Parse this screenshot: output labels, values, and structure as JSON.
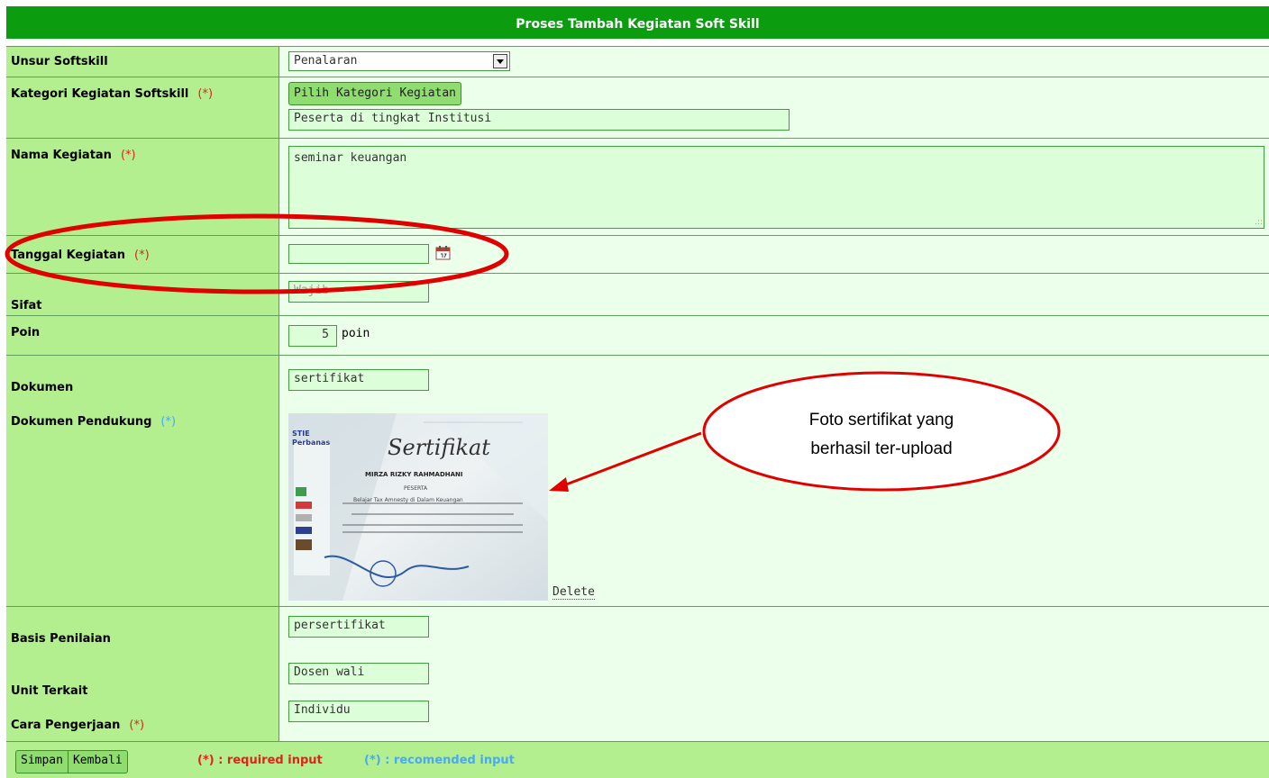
{
  "form": {
    "title": "Proses Tambah Kegiatan Soft Skill",
    "required_marker": "(*)",
    "recommended_marker": "(*)",
    "fields": {
      "unsur": {
        "label": "Unsur Softskill",
        "value": "Penalaran"
      },
      "kategori": {
        "label": "Kategori Kegiatan Softskill",
        "button": "Pilih Kategori Kegiatan",
        "value": "Peserta di tingkat Institusi"
      },
      "nama": {
        "label": "Nama Kegiatan",
        "value": "seminar keuangan"
      },
      "tanggal": {
        "label": "Tanggal Kegiatan",
        "value": ""
      },
      "sifat": {
        "label": "Sifat",
        "value": "Wajib"
      },
      "poin": {
        "label": "Poin",
        "value": "5",
        "unit": "poin"
      },
      "dokumen": {
        "label": "Dokumen",
        "value": "sertifikat"
      },
      "dokumen_pendukung": {
        "label": "Dokumen Pendukung",
        "delete_label": "Delete"
      },
      "basis": {
        "label": "Basis Penilaian",
        "value": "persertifikat"
      },
      "unit": {
        "label": "Unit Terkait",
        "value": "Dosen wali"
      },
      "cara": {
        "label": "Cara Pengerjaan",
        "value": "Individu"
      }
    },
    "buttons": {
      "simpan": "Simpan",
      "kembali": "Kembali"
    },
    "legend": {
      "required": "(*) : required input",
      "recommended": "(*) : recomended input"
    }
  },
  "certificate": {
    "title": "Sertifikat",
    "logo_text": "STIE Perbanas",
    "name_text": "MIRZA RIZKY RAHMADHANI",
    "role_text": "PESERTA",
    "event_text": "Belajar Tax Amnesty di Dalam Keuangan"
  },
  "callout": {
    "line1": "Foto sertifikat yang",
    "line2": "berhasil ter-upload"
  },
  "colors": {
    "header": "#0b9c10",
    "label_bg": "#b3ee8f",
    "value_bg": "#ecffea",
    "required": "#e0231d",
    "recommended": "#49a9f2",
    "annotation": "#e00000"
  }
}
